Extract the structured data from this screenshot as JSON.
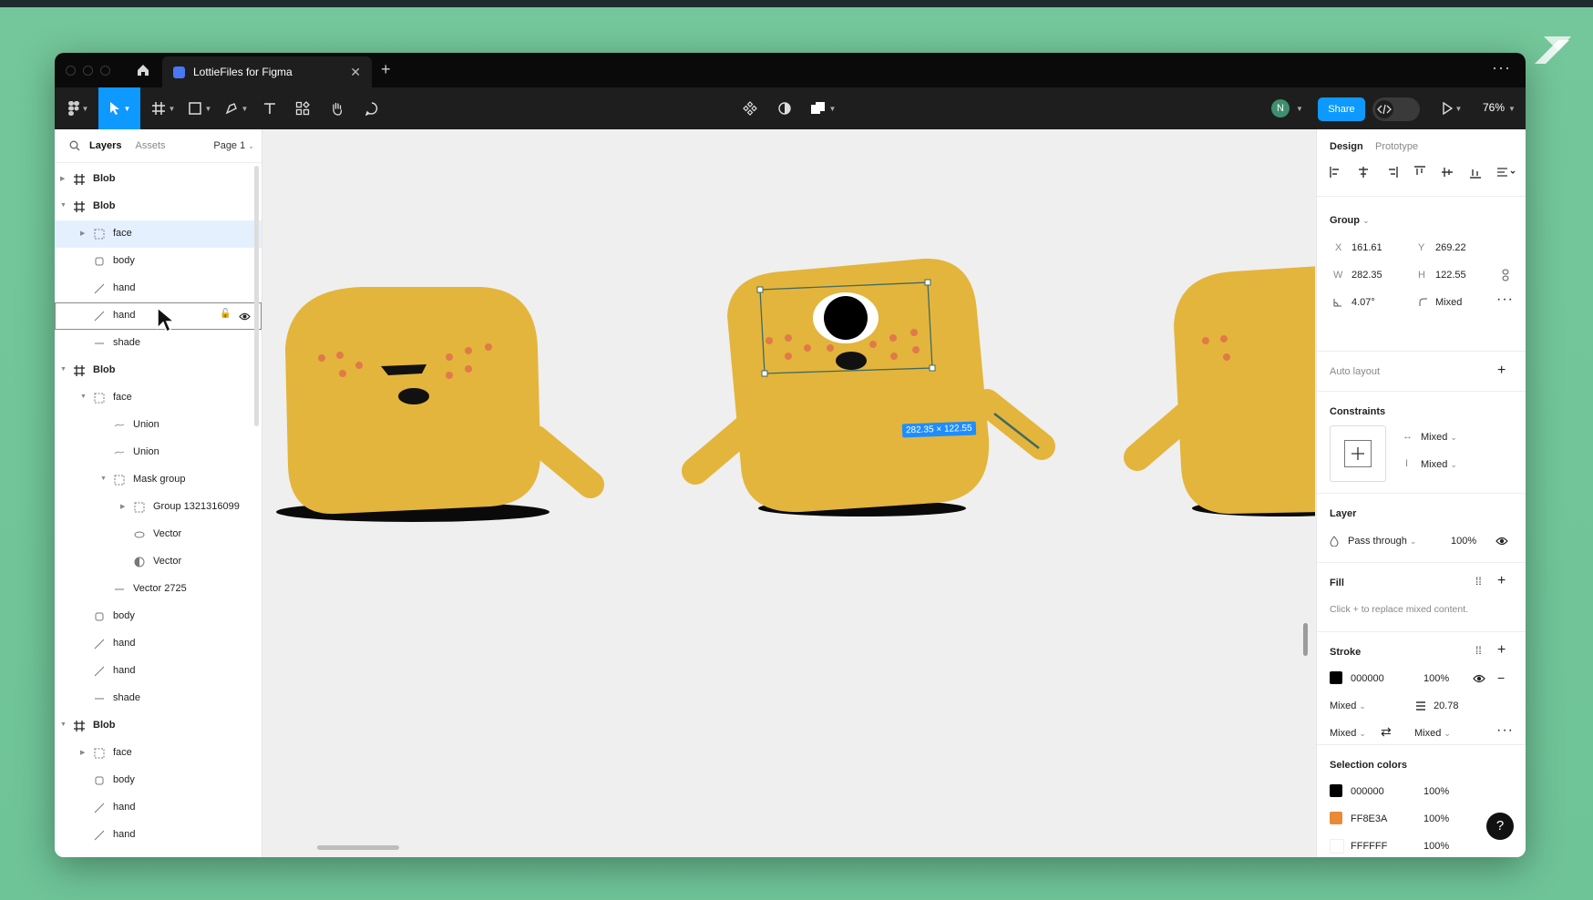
{
  "window": {
    "tab_title": "LottieFiles for Figma",
    "new_tab": "+",
    "more": "···"
  },
  "toolbar": {
    "share_label": "Share",
    "avatar_initial": "N",
    "zoom": "76%"
  },
  "left_panel": {
    "tabs": [
      "Layers",
      "Assets"
    ],
    "page": "Page 1",
    "layers": [
      {
        "name": "Blob",
        "icon": "frame-icon",
        "depth": 0,
        "expanded": false,
        "bold": true
      },
      {
        "name": "Blob",
        "icon": "frame-icon",
        "depth": 0,
        "expanded": true,
        "bold": true
      },
      {
        "name": "face",
        "icon": "group-icon",
        "depth": 1,
        "expanded": false,
        "selected": true
      },
      {
        "name": "body",
        "icon": "rect-icon",
        "depth": 1
      },
      {
        "name": "hand",
        "icon": "line-icon",
        "depth": 1
      },
      {
        "name": "hand",
        "icon": "line-icon",
        "depth": 1,
        "hover": true
      },
      {
        "name": "shade",
        "icon": "dash-icon",
        "depth": 1
      },
      {
        "name": "Blob",
        "icon": "frame-icon",
        "depth": 0,
        "expanded": true,
        "bold": true
      },
      {
        "name": "face",
        "icon": "group-icon",
        "depth": 1,
        "expanded": true
      },
      {
        "name": "Union",
        "icon": "union-icon",
        "depth": 2
      },
      {
        "name": "Union",
        "icon": "union-icon",
        "depth": 2
      },
      {
        "name": "Mask group",
        "icon": "group-icon",
        "depth": 2,
        "expanded": true
      },
      {
        "name": "Group 1321316099",
        "icon": "group-icon",
        "depth": 3,
        "expanded": false
      },
      {
        "name": "Vector",
        "icon": "ellipse-icon",
        "depth": 3
      },
      {
        "name": "Vector",
        "icon": "half-circle-icon",
        "depth": 3
      },
      {
        "name": "Vector 2725",
        "icon": "dash-icon",
        "depth": 2
      },
      {
        "name": "body",
        "icon": "rect-icon",
        "depth": 1
      },
      {
        "name": "hand",
        "icon": "line-icon",
        "depth": 1
      },
      {
        "name": "hand",
        "icon": "line-icon",
        "depth": 1
      },
      {
        "name": "shade",
        "icon": "dash-icon",
        "depth": 1
      },
      {
        "name": "Blob",
        "icon": "frame-icon",
        "depth": 0,
        "expanded": true,
        "bold": true
      },
      {
        "name": "face",
        "icon": "group-icon",
        "depth": 1,
        "expanded": false
      },
      {
        "name": "body",
        "icon": "rect-icon",
        "depth": 1
      },
      {
        "name": "hand",
        "icon": "line-icon",
        "depth": 1
      },
      {
        "name": "hand",
        "icon": "line-icon",
        "depth": 1
      }
    ]
  },
  "canvas": {
    "dimension_label": "282.35 × 122.55",
    "blob_color": "#e4b53c",
    "freckle_color": "#e07a4a"
  },
  "right_panel": {
    "tabs": [
      "Design",
      "Prototype"
    ],
    "group_label": "Group",
    "x_label": "X",
    "x": "161.61",
    "y_label": "Y",
    "y": "269.22",
    "w_label": "W",
    "w": "282.35",
    "h_label": "H",
    "h": "122.55",
    "rotation": "4.07°",
    "radius": "Mixed",
    "auto_layout": "Auto layout",
    "constraints_title": "Constraints",
    "constraint_h": "Mixed",
    "constraint_v": "Mixed",
    "layer_title": "Layer",
    "blend": "Pass through",
    "opacity": "100%",
    "fill_title": "Fill",
    "fill_hint": "Click + to replace mixed content.",
    "stroke_title": "Stroke",
    "stroke_color": "000000",
    "stroke_opacity": "100%",
    "stroke_position": "Mixed",
    "stroke_weight": "20.78",
    "stroke_cap_start": "Mixed",
    "stroke_cap_end": "Mixed",
    "selection_colors_title": "Selection colors",
    "selection_colors": [
      {
        "hex": "000000",
        "opacity": "100%",
        "color": "#000000"
      },
      {
        "hex": "FF8E3A",
        "opacity": "100%",
        "color": "#e88a36"
      },
      {
        "hex": "FFFFFF",
        "opacity": "100%",
        "color": "#ffffff"
      }
    ]
  },
  "help_label": "?"
}
